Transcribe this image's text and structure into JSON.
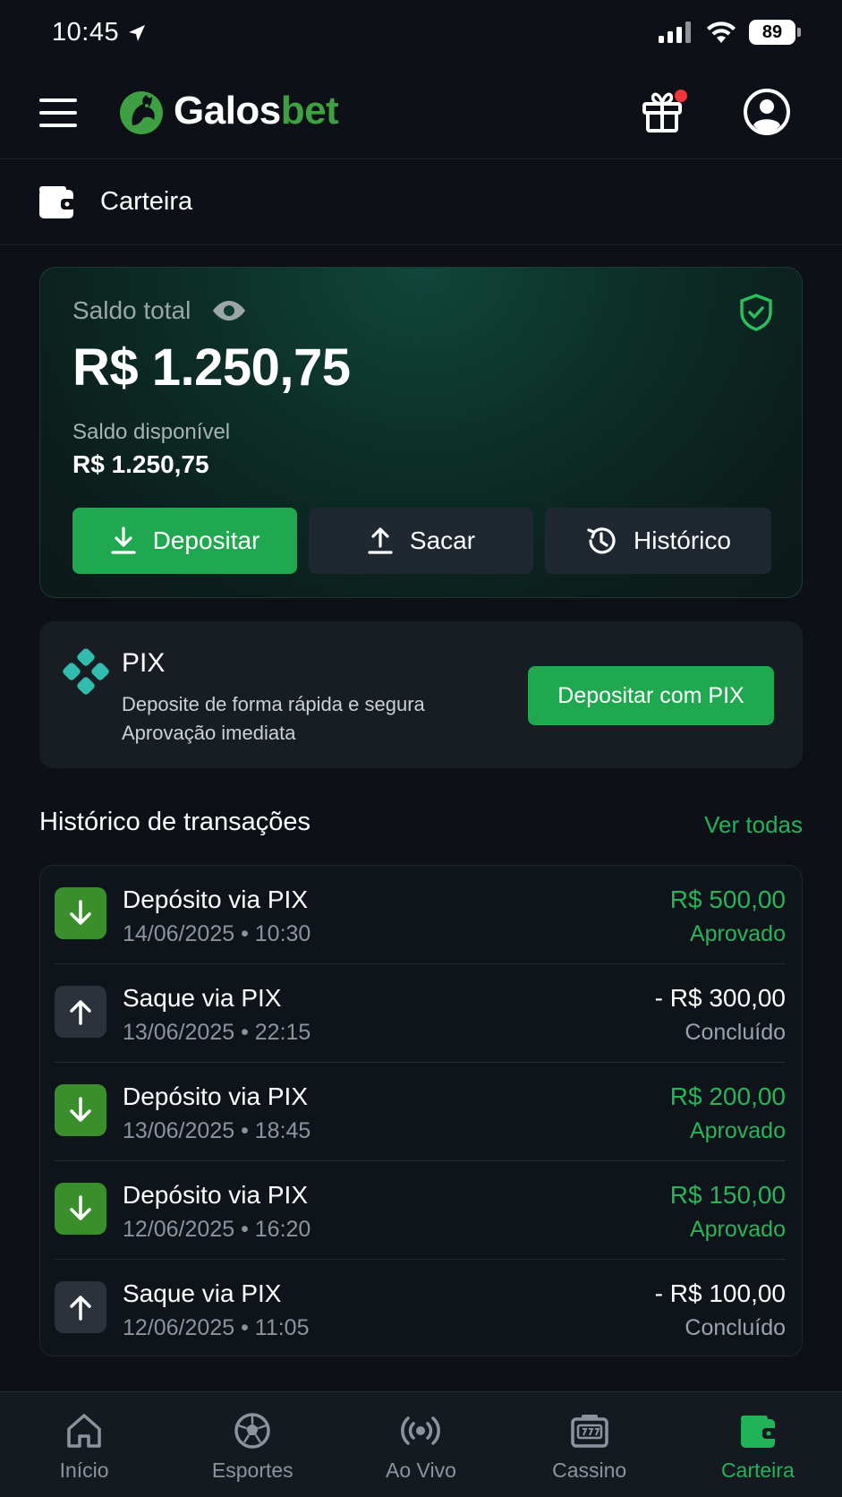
{
  "status_bar": {
    "time": "10:45",
    "battery": "89"
  },
  "header": {
    "brand_part1": "Galos",
    "brand_part2": "bet"
  },
  "page": {
    "title": "Carteira"
  },
  "balance": {
    "label": "Saldo total",
    "value": "R$ 1.250,75",
    "available_label": "Saldo disponível",
    "available_value": "R$ 1.250,75",
    "actions": {
      "deposit": "Depositar",
      "withdraw": "Sacar",
      "history": "Histórico"
    }
  },
  "pix": {
    "title": "PIX",
    "desc1": "Deposite de forma rápida e segura",
    "desc2": "Aprovação imediata",
    "button": "Depositar com PIX"
  },
  "history": {
    "title": "Histórico de transações",
    "see_all": "Ver todas",
    "transactions": [
      {
        "title": "Depósito via PIX",
        "date": "14/06/2025 • 10:30",
        "amount": "R$ 500,00",
        "status": "Aprovado",
        "kind": "deposit"
      },
      {
        "title": "Saque via PIX",
        "date": "13/06/2025 • 22:15",
        "amount": "- R$ 300,00",
        "status": "Concluído",
        "kind": "withdraw"
      },
      {
        "title": "Depósito via PIX",
        "date": "13/06/2025 • 18:45",
        "amount": "R$ 200,00",
        "status": "Aprovado",
        "kind": "deposit"
      },
      {
        "title": "Depósito via PIX",
        "date": "12/06/2025 • 16:20",
        "amount": "R$ 150,00",
        "status": "Aprovado",
        "kind": "deposit"
      },
      {
        "title": "Saque via PIX",
        "date": "12/06/2025 • 11:05",
        "amount": "- R$ 100,00",
        "status": "Concluído",
        "kind": "withdraw"
      }
    ]
  },
  "nav": {
    "items": [
      {
        "label": "Início",
        "icon": "home-icon"
      },
      {
        "label": "Esportes",
        "icon": "soccer-ball-icon"
      },
      {
        "label": "Ao Vivo",
        "icon": "live-broadcast-icon"
      },
      {
        "label": "Cassino",
        "icon": "slot-machine-icon"
      },
      {
        "label": "Carteira",
        "icon": "wallet-icon"
      }
    ],
    "active": "Carteira"
  },
  "colors": {
    "background": "#0d1117",
    "accent_green": "#1fa84f",
    "brand_green": "#3ea043",
    "notification_dot": "#f0353c"
  }
}
